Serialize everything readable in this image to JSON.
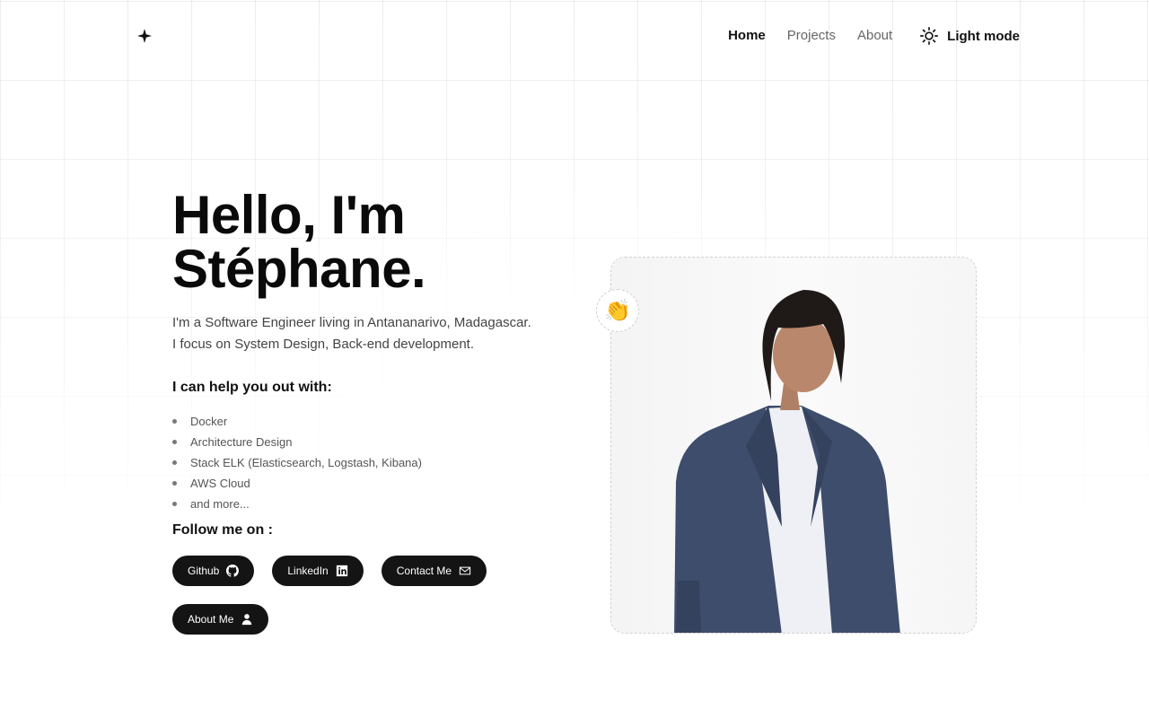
{
  "header": {
    "logo_icon": "sparkle-icon",
    "nav": [
      {
        "label": "Home",
        "active": true
      },
      {
        "label": "Projects",
        "active": false
      },
      {
        "label": "About",
        "active": false
      }
    ],
    "theme_toggle": {
      "icon": "sun-icon",
      "label": "Light mode"
    }
  },
  "hero": {
    "title_line1": "Hello, I'm",
    "title_line2": "Stéphane.",
    "intro_line1": "I'm a Software Engineer living in Antananarivo, Madagascar.",
    "intro_line2": "I focus on System Design, Back-end development.",
    "help_title": "I can help you out with:",
    "skills": [
      "Docker",
      "Architecture Design",
      "Stack ELK (Elasticsearch, Logstash, Kibana)",
      "AWS Cloud",
      "and more..."
    ],
    "follow_title": "Follow me on :",
    "buttons": [
      {
        "label": "Github",
        "icon": "github-icon"
      },
      {
        "label": "LinkedIn",
        "icon": "linkedin-icon"
      },
      {
        "label": "Contact Me",
        "icon": "mail-icon"
      },
      {
        "label": "About Me",
        "icon": "user-icon"
      }
    ]
  },
  "photo": {
    "wave_emoji": "👏",
    "alt": "portrait-photo"
  },
  "colors": {
    "primary": "#141414",
    "muted_text": "#666666",
    "background": "#ffffff"
  }
}
